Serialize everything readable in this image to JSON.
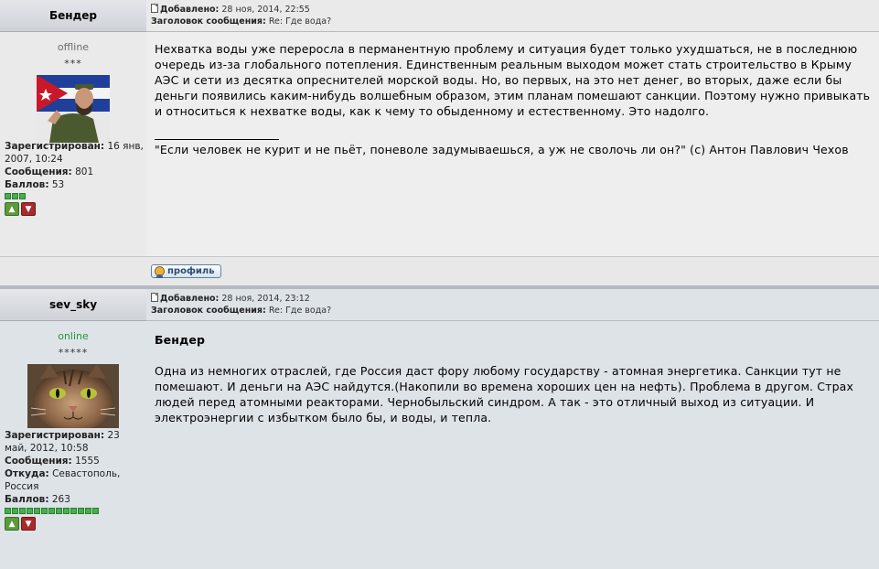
{
  "posts": [
    {
      "author": "Бендер",
      "status": "offline",
      "rank": "***",
      "registered_label": "Зарегистрирован:",
      "registered": "16 янв, 2007, 10:24",
      "messages_label": "Сообщения:",
      "messages": "801",
      "score_label": "Баллов:",
      "score": "53",
      "pips": 3,
      "added_label": "Добавлено:",
      "added": "28 ноя, 2014, 22:55",
      "subject_label": "Заголовок сообщения:",
      "subject": "Re: Где вода?",
      "body": "Нехватка воды уже переросла в перманентную проблему и ситуация будет только ухудшаться, не в последнюю очередь из-за глобального потепления. Единственным реальным выходом может стать строительство в Крыму АЭС и сети из десятка опреснителей морской воды. Но, во первых, на это нет денег, во вторых, даже если бы деньги появились каким-нибудь волшебным образом, этим планам помешают санкции. Поэтому нужно привыкать и относиться к нехватке воды, как к чему то обыденному и естественному. Это надолго.",
      "signature": "\"Если человек не курит и не пьёт, поневоле задумываешься, а уж не сволочь ли он?\" (с) Антон Павлович Чехов",
      "profile_button": "профиль"
    },
    {
      "author": "sev_sky",
      "status": "online",
      "rank": "*****",
      "registered_label": "Зарегистрирован:",
      "registered": "23 май, 2012, 10:58",
      "messages_label": "Сообщения:",
      "messages": "1555",
      "location_label": "Откуда:",
      "location": "Севастополь, Россия",
      "score_label": "Баллов:",
      "score": "263",
      "pips": 13,
      "added_label": "Добавлено:",
      "added": "28 ноя, 2014, 23:12",
      "subject_label": "Заголовок сообщения:",
      "subject": "Re: Где вода?",
      "quote_name": "Бендер",
      "body": "Одна из немногих отраслей, где Россия даст фору любому государству - атомная энергетика. Санкции тут не помешают. И деньги на АЭС найдутся.(Накопили во времена хороших цен на нефть). Проблема в другом. Страх людей перед атомными реакторами. Чернобыльский синдром. А так - это отличный выход из ситуации. И электроэнергии с избытком было бы, и воды, и тепла."
    }
  ],
  "icons": {
    "post_icon": "document-icon",
    "vote_up": "thumbs-up-icon",
    "vote_down": "thumbs-down-icon",
    "profile": "user-icon"
  },
  "colors": {
    "online": "#229933",
    "offline": "#6b6b6b",
    "pip": "#44b04a"
  }
}
